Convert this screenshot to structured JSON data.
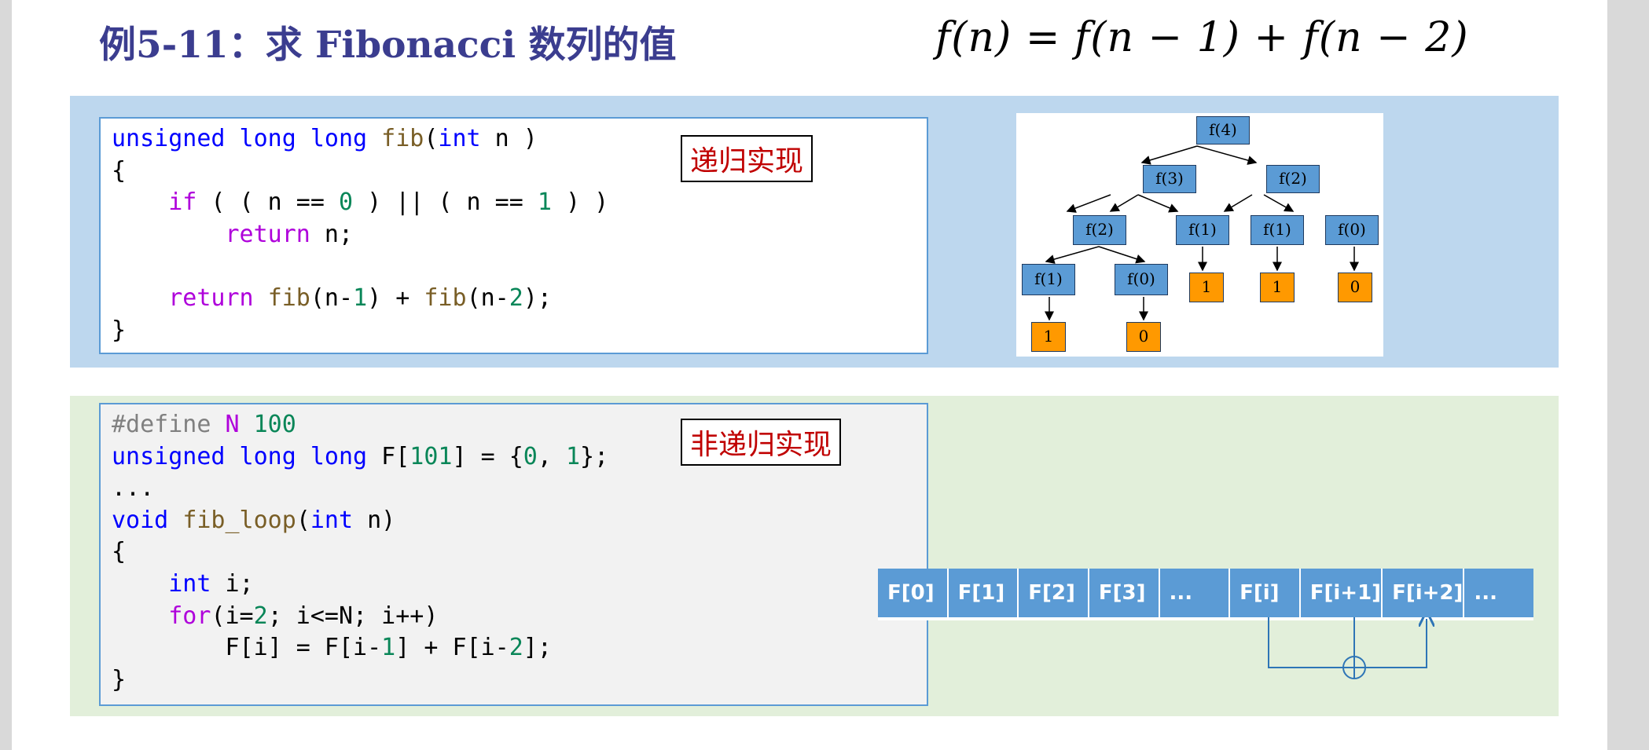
{
  "title": "例5-11：求 Fibonacci 数列的值",
  "formula": {
    "lhs": "f(n)",
    "eq": "=",
    "t1": "f(n − 1)",
    "plus": "+",
    "t2": "f(n − 2)"
  },
  "recursive": {
    "tag": "递归实现",
    "code": [
      [
        {
          "t": "unsigned long long ",
          "c": "kw"
        },
        {
          "t": "fib",
          "c": "fn"
        },
        {
          "t": "(",
          "c": ""
        },
        {
          "t": "int",
          "c": "kw"
        },
        {
          "t": " n )",
          "c": ""
        }
      ],
      [
        {
          "t": "{",
          "c": ""
        }
      ],
      [
        {
          "t": "    ",
          "c": ""
        },
        {
          "t": "if",
          "c": "kw2"
        },
        {
          "t": " ( ( n == ",
          "c": ""
        },
        {
          "t": "0",
          "c": "num"
        },
        {
          "t": " ) || ( n == ",
          "c": ""
        },
        {
          "t": "1",
          "c": "num"
        },
        {
          "t": " ) )",
          "c": ""
        }
      ],
      [
        {
          "t": "        ",
          "c": ""
        },
        {
          "t": "return",
          "c": "kw2"
        },
        {
          "t": " n;",
          "c": ""
        }
      ],
      [
        {
          "t": "",
          "c": ""
        }
      ],
      [
        {
          "t": "    ",
          "c": ""
        },
        {
          "t": "return",
          "c": "kw2"
        },
        {
          "t": " ",
          "c": ""
        },
        {
          "t": "fib",
          "c": "fn"
        },
        {
          "t": "(n-",
          "c": ""
        },
        {
          "t": "1",
          "c": "num"
        },
        {
          "t": ") + ",
          "c": ""
        },
        {
          "t": "fib",
          "c": "fn"
        },
        {
          "t": "(n-",
          "c": ""
        },
        {
          "t": "2",
          "c": "num"
        },
        {
          "t": ");",
          "c": ""
        }
      ],
      [
        {
          "t": "}",
          "c": ""
        }
      ]
    ]
  },
  "iterative": {
    "tag": "非递归实现",
    "code": [
      [
        {
          "t": "#define",
          "c": "pp"
        },
        {
          "t": " ",
          "c": ""
        },
        {
          "t": "N",
          "c": "macro"
        },
        {
          "t": " ",
          "c": ""
        },
        {
          "t": "100",
          "c": "num"
        }
      ],
      [
        {
          "t": "unsigned long long ",
          "c": "kw"
        },
        {
          "t": "F[",
          "c": ""
        },
        {
          "t": "101",
          "c": "num"
        },
        {
          "t": "] = {",
          "c": ""
        },
        {
          "t": "0",
          "c": "num"
        },
        {
          "t": ", ",
          "c": ""
        },
        {
          "t": "1",
          "c": "num"
        },
        {
          "t": "};",
          "c": ""
        }
      ],
      [
        {
          "t": "...",
          "c": ""
        }
      ],
      [
        {
          "t": "void",
          "c": "kw"
        },
        {
          "t": " ",
          "c": ""
        },
        {
          "t": "fib_loop",
          "c": "fn"
        },
        {
          "t": "(",
          "c": ""
        },
        {
          "t": "int",
          "c": "kw"
        },
        {
          "t": " n)",
          "c": ""
        }
      ],
      [
        {
          "t": "{",
          "c": ""
        }
      ],
      [
        {
          "t": "    ",
          "c": ""
        },
        {
          "t": "int",
          "c": "kw"
        },
        {
          "t": " i;",
          "c": ""
        }
      ],
      [
        {
          "t": "    ",
          "c": ""
        },
        {
          "t": "for",
          "c": "kw2"
        },
        {
          "t": "(i=",
          "c": ""
        },
        {
          "t": "2",
          "c": "num"
        },
        {
          "t": "; i<=N; i++)",
          "c": ""
        }
      ],
      [
        {
          "t": "        F[i] = F[i-",
          "c": ""
        },
        {
          "t": "1",
          "c": "num"
        },
        {
          "t": "] + F[i-",
          "c": ""
        },
        {
          "t": "2",
          "c": "num"
        },
        {
          "t": "];",
          "c": ""
        }
      ],
      [
        {
          "t": "}",
          "c": ""
        }
      ]
    ]
  },
  "tree": {
    "root": "f(4)",
    "l1": [
      "f(3)",
      "f(2)"
    ],
    "l2": [
      "f(2)",
      "f(1)",
      "f(1)",
      "f(0)"
    ],
    "l3": [
      "f(1)",
      "f(0)"
    ],
    "leaves_mid": [
      "1",
      "1",
      "0"
    ],
    "leaves_bottom": [
      "1",
      "0"
    ]
  },
  "array_cells": [
    "F[0]",
    "F[1]",
    "F[2]",
    "F[3]",
    "...",
    "F[i]",
    "F[i+1]",
    "F[i+2]",
    "..."
  ],
  "colors": {
    "title": "#3b3d8f",
    "blue_panel": "#bdd7ee",
    "green_panel": "#e2efda",
    "node": "#5b9bd5",
    "leaf": "#ff9900",
    "tag_text": "#c00000"
  }
}
